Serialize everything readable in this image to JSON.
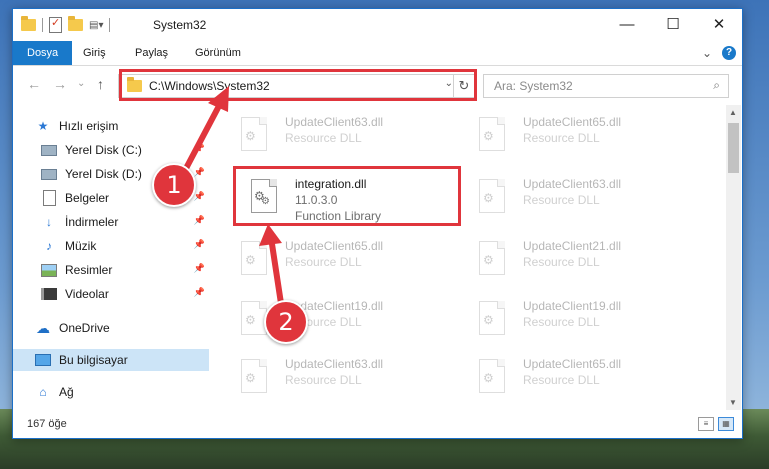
{
  "window": {
    "title": "System32",
    "caption": {
      "minimize": "—",
      "maximize": "☐",
      "close": "✕"
    }
  },
  "ribbon": {
    "tabs": [
      {
        "label": "Dosya",
        "active": true
      },
      {
        "label": "Giriş"
      },
      {
        "label": "Paylaş"
      },
      {
        "label": "Görünüm"
      }
    ],
    "expand": "⌄",
    "help": "?"
  },
  "navigation": {
    "back": "←",
    "forward": "→",
    "recent": "⌄",
    "up": "↑",
    "address": "C:\\Windows\\System32",
    "address_dropdown": "⌄",
    "refresh": "↻",
    "search_placeholder": "Ara: System32",
    "search_icon": "⌕"
  },
  "sidebar": {
    "items": [
      {
        "label": "Hızlı erişim",
        "icon": "star-icon"
      },
      {
        "label": "Yerel Disk (C:)",
        "icon": "drive-icon",
        "pinned": true
      },
      {
        "label": "Yerel Disk (D:)",
        "icon": "drive-icon",
        "pinned": true
      },
      {
        "label": "Belgeler",
        "icon": "document-icon",
        "pinned": true
      },
      {
        "label": "İndirmeler",
        "icon": "download-icon",
        "pinned": true
      },
      {
        "label": "Müzik",
        "icon": "music-icon",
        "pinned": true
      },
      {
        "label": "Resimler",
        "icon": "pictures-icon",
        "pinned": true
      },
      {
        "label": "Videolar",
        "icon": "videos-icon",
        "pinned": true
      },
      {
        "label": "OneDrive",
        "icon": "cloud-icon"
      },
      {
        "label": "Bu bilgisayar",
        "icon": "computer-icon",
        "selected": true
      },
      {
        "label": "Ağ",
        "icon": "network-icon"
      }
    ],
    "pin_glyph": "📌"
  },
  "files": [
    {
      "name": "UpdateClient63.dll",
      "desc": "Resource DLL",
      "faded": true
    },
    {
      "name": "UpdateClient65.dll",
      "desc": "Resource DLL",
      "faded": true
    },
    {
      "name": "integration.dll",
      "desc": "11.0.3.0",
      "desc2": "Function Library",
      "faded": false,
      "highlighted": true
    },
    {
      "name": "UpdateClient63.dll",
      "desc": "Resource DLL",
      "faded": true
    },
    {
      "name": "UpdateClient65.dll",
      "desc": "Resource DLL",
      "faded": true
    },
    {
      "name": "UpdateClient21.dll",
      "desc": "Resource DLL",
      "faded": true
    },
    {
      "name": "UpdateClient19.dll",
      "desc": "Resource DLL",
      "faded": true
    },
    {
      "name": "UpdateClient19.dll",
      "desc": "Resource DLL",
      "faded": true
    },
    {
      "name": "UpdateClient63.dll",
      "desc": "Resource DLL",
      "faded": true
    },
    {
      "name": "UpdateClient65.dll",
      "desc": "Resource DLL",
      "faded": true
    }
  ],
  "status": {
    "item_count": "167 öğe"
  },
  "annotations": {
    "step1": "1",
    "step2": "2",
    "color": "#e0353c"
  },
  "colors": {
    "accent": "#1979ca",
    "selection": "#cce4f7",
    "highlight": "#e0353c"
  }
}
